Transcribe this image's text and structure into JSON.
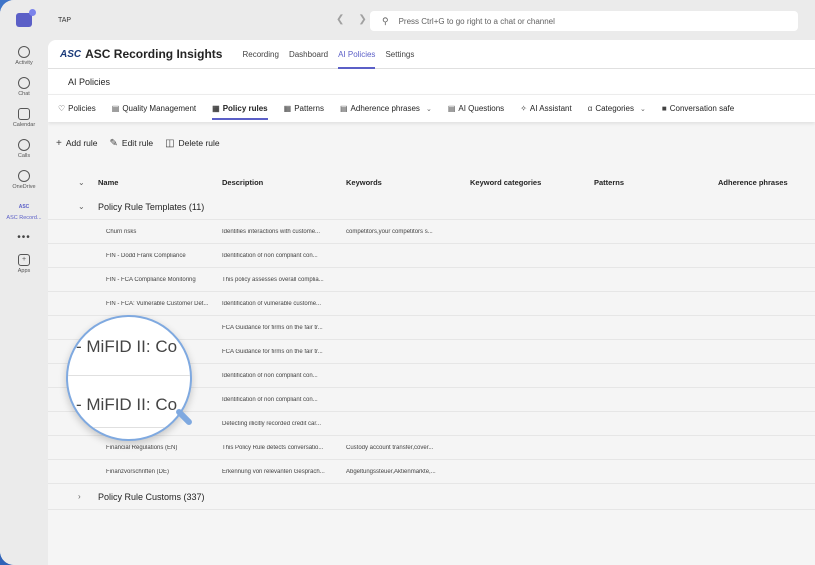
{
  "topbar": {
    "tenant": "TAP",
    "search_placeholder": "Press Ctrl+G to go right to a chat or channel"
  },
  "rail": {
    "items": [
      {
        "label": "Activity",
        "icon": "bell-icon"
      },
      {
        "label": "Chat",
        "icon": "chat-icon"
      },
      {
        "label": "Calendar",
        "icon": "calendar-icon"
      },
      {
        "label": "Calls",
        "icon": "phone-icon"
      },
      {
        "label": "OneDrive",
        "icon": "cloud-icon"
      },
      {
        "label": "ASC Record...",
        "icon": "asc-logo-icon"
      }
    ],
    "more": "•••",
    "apps_label": "Apps"
  },
  "app": {
    "logo": "ASC",
    "title": "ASC Recording Insights",
    "tabs": [
      "Recording",
      "Dashboard",
      "AI Policies",
      "Settings"
    ],
    "active_tab": "AI Policies"
  },
  "section_title": "AI Policies",
  "subtabs": [
    {
      "label": "Policies",
      "icon": "shield-icon"
    },
    {
      "label": "Quality Management",
      "icon": "clipboard-icon"
    },
    {
      "label": "Policy rules",
      "icon": "rules-icon",
      "active": true
    },
    {
      "label": "Patterns",
      "icon": "pattern-icon"
    },
    {
      "label": "Adherence phrases",
      "icon": "document-icon",
      "dropdown": true
    },
    {
      "label": "AI Questions",
      "icon": "question-doc-icon"
    },
    {
      "label": "AI Assistant",
      "icon": "assistant-icon"
    },
    {
      "label": "Categories",
      "icon": "categories-icon",
      "dropdown": true
    },
    {
      "label": "Conversation safe",
      "icon": "lock-icon"
    }
  ],
  "toolbar": {
    "add": "Add rule",
    "edit": "Edit rule",
    "delete": "Delete rule"
  },
  "columns": [
    "Name",
    "Description",
    "Keywords",
    "Keyword categories",
    "Patterns",
    "Adherence phrases"
  ],
  "groups": [
    {
      "label": "Policy Rule Templates (11)",
      "rows": [
        {
          "name": "Churn risks",
          "description": "Identifies interactions with custome...",
          "keywords": "competitors,your competitors s..."
        },
        {
          "name": "FIN - Dodd Frank Compliance",
          "description": "Identification of non compliant con...",
          "keywords": ""
        },
        {
          "name": "FIN - FCA Compliance Monitoring",
          "description": "This policy assesses overall complia...",
          "keywords": ""
        },
        {
          "name": "FIN - FCA: Vulnerable Customer Det...",
          "description": "Identification of vulnerable custome...",
          "keywords": ""
        },
        {
          "name": "e Customer Det...",
          "description": "FCA Guidance for firms on the fair tr...",
          "keywords": ""
        },
        {
          "name": "mer Tre...",
          "description": "FCA Guidance for firms on the fair tr...",
          "keywords": ""
        },
        {
          "name": "onitori...",
          "description": "Identification of non compliant con...",
          "keywords": ""
        },
        {
          "name": "onitori...",
          "description": "Identification of non compliant con...",
          "keywords": ""
        },
        {
          "name": "de Card Inf...",
          "description": "Detecting illicitly recorded credit car...",
          "keywords": ""
        },
        {
          "name": "Financial Regulations (EN)",
          "description": "This Policy Rule detects conversatio...",
          "keywords": "Custody account transfer,cover..."
        },
        {
          "name": "Finanzvorschriften (DE)",
          "description": "Erkennung von relevanten Gespräch...",
          "keywords": "Abgeltungssteuer,Aktienmarkte,..."
        }
      ]
    },
    {
      "label": "Policy Rule Customs (337)"
    }
  ],
  "magnifier": {
    "line1": "- MiFID II: Co",
    "line2": "- MiFID II: Co"
  }
}
